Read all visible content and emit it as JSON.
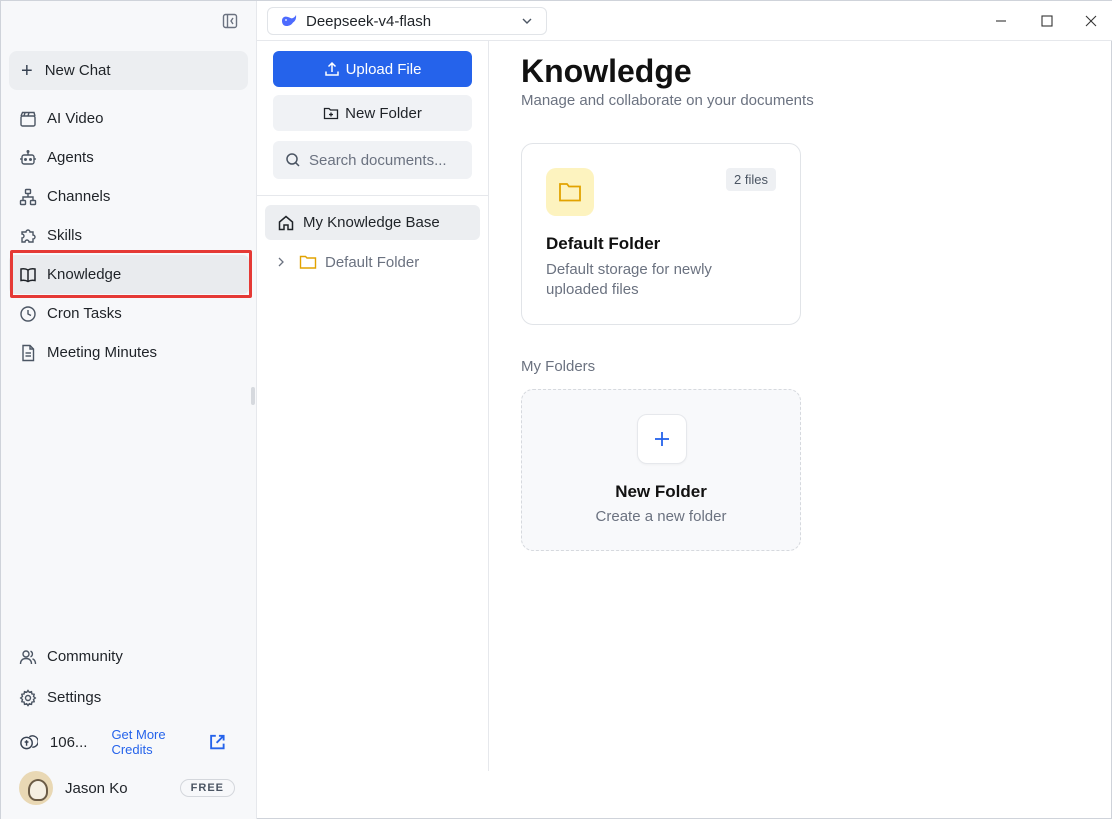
{
  "colors": {
    "accent": "#2563eb",
    "highlight": "#e53935",
    "folder": "#e2a300",
    "folder_bg": "#fdf3bf"
  },
  "header": {
    "model_name": "Deepseek-v4-flash"
  },
  "sidebar": {
    "new_chat_label": "New Chat",
    "items": [
      {
        "label": "AI Video",
        "icon": "clapperboard-icon"
      },
      {
        "label": "Agents",
        "icon": "robot-icon"
      },
      {
        "label": "Channels",
        "icon": "network-icon"
      },
      {
        "label": "Skills",
        "icon": "puzzle-icon"
      },
      {
        "label": "Knowledge",
        "icon": "book-icon",
        "active": true
      },
      {
        "label": "Cron Tasks",
        "icon": "clock-icon"
      },
      {
        "label": "Meeting Minutes",
        "icon": "document-icon"
      }
    ],
    "bottom_items": [
      {
        "label": "Community",
        "icon": "users-icon"
      },
      {
        "label": "Settings",
        "icon": "gear-icon"
      }
    ],
    "credits_value": "106...",
    "credits_link": "Get More Credits",
    "user_name": "Jason Ko",
    "plan_badge": "FREE"
  },
  "knowledge_panel": {
    "upload_label": "Upload File",
    "new_folder_label": "New Folder",
    "search_placeholder": "Search documents...",
    "root_label": "My Knowledge Base",
    "child_label": "Default Folder"
  },
  "main": {
    "title": "Knowledge",
    "subtitle": "Manage and collaborate on your documents",
    "default_card": {
      "title": "Default Folder",
      "description": "Default storage for newly uploaded files",
      "file_count": "2 files"
    },
    "section_label": "My Folders",
    "new_folder_card": {
      "title": "New Folder",
      "description": "Create a new folder"
    }
  }
}
